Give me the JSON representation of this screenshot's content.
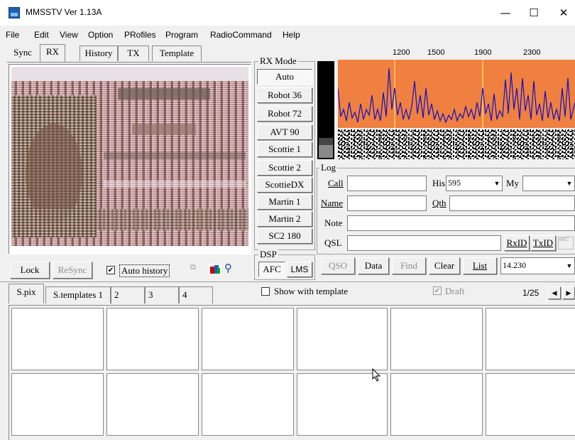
{
  "window": {
    "title": "MMSSTV Ver 1.13A",
    "minimize": "—",
    "maximize": "☐",
    "close": "✕"
  },
  "menu": [
    "File",
    "Edit",
    "View",
    "Option",
    "PRofiles",
    "Program",
    "RadioCommand",
    "Help"
  ],
  "tabs": [
    "Sync",
    "RX",
    "History",
    "TX",
    "Template"
  ],
  "rx_mode": {
    "title": "RX Mode",
    "modes": [
      "Auto",
      "Robot 36",
      "Robot 72",
      "AVT 90",
      "Scottie 1",
      "Scottie 2",
      "ScottieDX",
      "Martin 1",
      "Martin 2",
      "SC2 180"
    ]
  },
  "spectrum": {
    "freq_labels": [
      "1200",
      "1500",
      "1900",
      "2300"
    ],
    "colors": {
      "background": "#f08040",
      "trace": "#1010c0",
      "marker": "#ffff66"
    }
  },
  "dsp": {
    "title": "DSP",
    "afc": "AFC",
    "lms": "LMS"
  },
  "log": {
    "title": "Log",
    "call_label": "Call",
    "call_value": "",
    "his_label": "His",
    "his_value": "595",
    "my_label": "My",
    "my_value": "",
    "name_label": "Name",
    "name_value": "",
    "qth_label": "Qth",
    "qth_value": "",
    "note_label": "Note",
    "note_value": "",
    "qsl_label": "QSL",
    "qsl_value": "",
    "rxid": "RxID",
    "txid": "TxID"
  },
  "controls": {
    "lock": "Lock",
    "resync": "ReSync",
    "auto_history": "Auto history",
    "auto_history_checked": true,
    "qso": "QSO",
    "data": "Data",
    "find": "Find",
    "clear": "Clear",
    "list": "List",
    "frequency": "14.230"
  },
  "bottom": {
    "tabs": [
      "S.pix",
      "S.templates 1",
      "2",
      "3",
      "4"
    ],
    "show_with_template": "Show with template",
    "draft": "Draft",
    "page": "1/25"
  }
}
